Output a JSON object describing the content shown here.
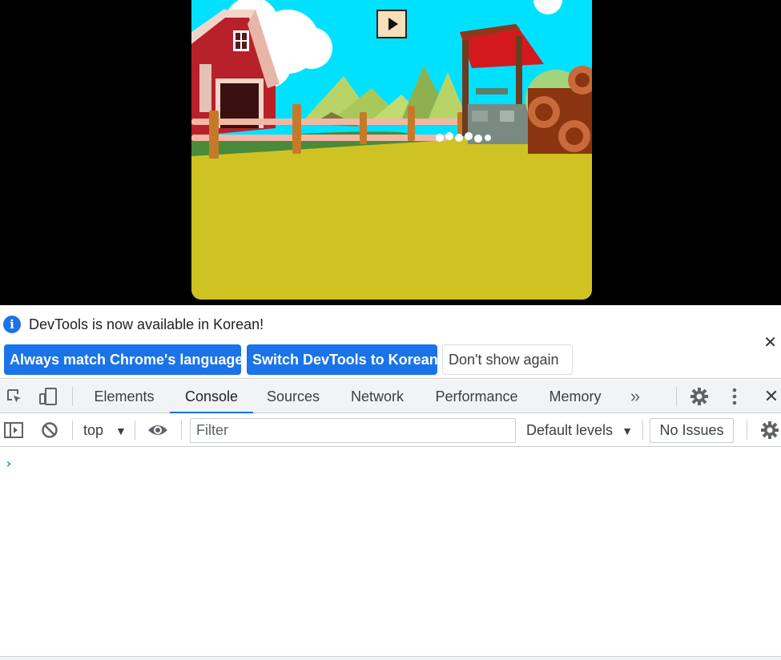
{
  "game": {
    "play_button_icon": "play-icon",
    "colors": {
      "sky": "#00e1ff",
      "ground": "#cfc323",
      "barn": "#b8202a",
      "roof": "#e04030"
    }
  },
  "devtools": {
    "infobar": {
      "icon": "info-icon",
      "message": "DevTools is now available in Korean!",
      "buttons": {
        "always_match": "Always match Chrome's language",
        "switch": "Switch DevTools to Korean",
        "dont_show": "Don't show again"
      },
      "close_icon": "close-icon"
    },
    "tabs": [
      "Elements",
      "Console",
      "Sources",
      "Network",
      "Performance",
      "Memory"
    ],
    "active_tab": "Console",
    "more_tabs_icon": "chevron-double-right-icon",
    "console_toolbar": {
      "context": "top",
      "filter_placeholder": "Filter",
      "levels": "Default levels",
      "issues": "No Issues"
    },
    "prompt_symbol": "›",
    "accent": "#1a73e8"
  }
}
